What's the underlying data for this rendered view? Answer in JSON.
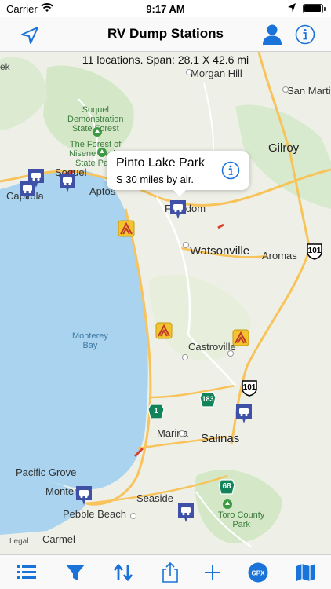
{
  "status_bar": {
    "carrier": "Carrier",
    "time": "9:17 AM"
  },
  "nav": {
    "title": "RV Dump Stations"
  },
  "map": {
    "summary": "11 locations. Span: 28.1 X 42.6 mi",
    "places": {
      "morgan_hill": "Morgan Hill",
      "san_martin": "San Martin",
      "gilroy": "Gilroy",
      "watsonville": "Watsonville",
      "aromas": "Aromas",
      "castroville": "Castroville",
      "marina": "Marina",
      "salinas": "Salinas",
      "pacific_grove": "Pacific Grove",
      "monterey": "Montere",
      "seaside": "Seaside",
      "pebble_beach": "Pebble Beach",
      "carmel": "Carmel",
      "soquel": "Soquel",
      "capitola": "Capitola",
      "aptos": "Aptos",
      "freedom": "Freedom",
      "ek": "ek",
      "monterey_bay": "Monterey\nBay",
      "soquel_forest": "Soquel\nDemonstration\nState Forest",
      "nisene_forest": "The Forest of\nNisene Marks\nState Park",
      "toro_park": "Toro County\nPark"
    },
    "shields": {
      "us101_a": "101",
      "us101_b": "101",
      "ca183": "183",
      "ca1": "1",
      "ca68": "68"
    },
    "callout": {
      "name": "Pinto Lake Park",
      "detail": "S 30 miles by air."
    },
    "legal": "Legal"
  },
  "colors": {
    "accent": "#1a73d9",
    "water": "#a9d3ee",
    "land": "#eef0e8",
    "park": "#cfe6c3",
    "pin": "#3f51a6",
    "camp": "#f4c430"
  },
  "icons": [
    "location-arrow-icon",
    "user-icon",
    "info-icon",
    "list-icon",
    "filter-icon",
    "sort-icon",
    "share-icon",
    "plus-icon",
    "gpx-icon",
    "map-icon"
  ],
  "toolbar": {
    "gpx_label": "GPX"
  }
}
